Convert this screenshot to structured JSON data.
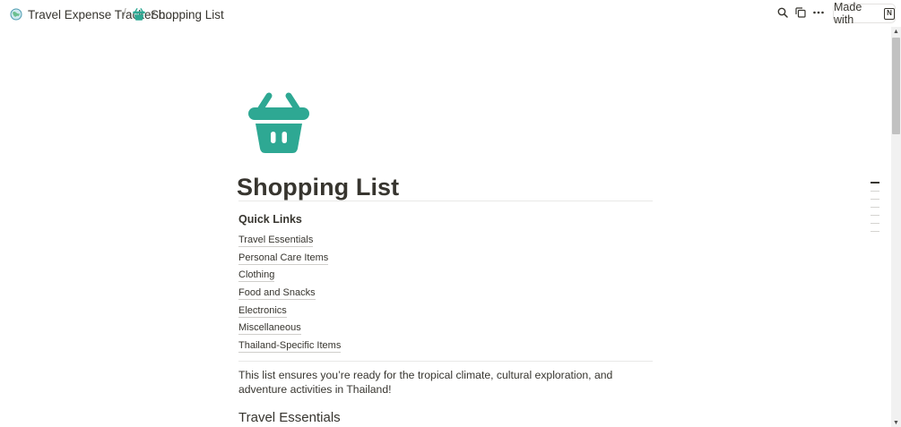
{
  "breadcrumb": {
    "items": [
      {
        "label": "Travel Expense Tracker b...",
        "icon": "globe-icon"
      },
      {
        "label": "Shopping List",
        "icon": "basket-icon"
      }
    ],
    "separator": "/"
  },
  "topbar": {
    "made_with_label": "Made with",
    "made_with_logo": "N"
  },
  "page": {
    "icon": "basket-icon",
    "icon_color": "#2ea893",
    "title": "Shopping List",
    "quick_links": {
      "title": "Quick Links",
      "items": [
        "Travel Essentials",
        "Personal Care Items",
        "Clothing",
        "Food and Snacks",
        "Electronics",
        "Miscellaneous",
        "Thailand-Specific Items"
      ]
    },
    "intro": "This list ensures you’re ready for the tropical climate, cultural exploration, and adventure activities in Thailand!",
    "first_section": "Travel Essentials"
  },
  "scrollbar": {
    "up_glyph": "▲",
    "down_glyph": "▼"
  }
}
